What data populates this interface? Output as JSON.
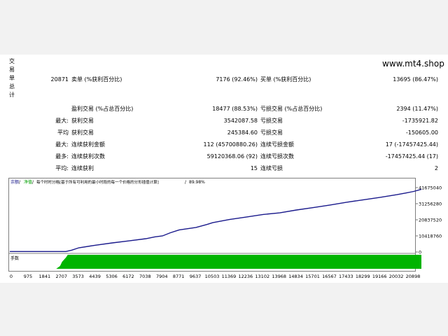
{
  "site_label": "www.mt4.shop",
  "side_label_chars": [
    "交",
    "易",
    "单",
    "总",
    "计"
  ],
  "rows": [
    {
      "c1": "",
      "c2": "20871",
      "c3": "卖单 (%获利百分比)",
      "c4": "7176 (92.46%)",
      "c5": "买单 (%获利百分比)",
      "c6": "13695 (86.47%)"
    },
    {
      "c1": "",
      "c2": "",
      "c3": "盈利交易 (%占总百分比)",
      "c4": "18477 (88.53%)",
      "c5": "亏损交易 (%占总百分比)",
      "c6": "2394 (11.47%)"
    },
    {
      "c1": "",
      "c2": "最大:",
      "c3": "获利交易",
      "c4": "3542087.58",
      "c5": "亏损交易",
      "c6": "-1735921.82"
    },
    {
      "c1": "",
      "c2": "平均",
      "c3": "获利交易",
      "c4": "245384.60",
      "c5": "亏损交易",
      "c6": "-150605.00"
    },
    {
      "c1": "",
      "c2": "最大:",
      "c3": "连续获利金额",
      "c4": "112 (45700880.26)",
      "c5": "连续亏损金额",
      "c6": "17 (-17457425.44)"
    },
    {
      "c1": "",
      "c2": "最多:",
      "c3": "连续获利次数",
      "c4": "59120368.06 (92)",
      "c5": "连续亏损次数",
      "c6": "-17457425.44 (17)"
    },
    {
      "c1": "",
      "c2": "平均:",
      "c3": "连续获利",
      "c4": "15",
      "c5": "连续亏损",
      "c6": "2"
    }
  ],
  "chart_header": {
    "balance": "余额",
    "equity": "净值",
    "caption": "每个时时分格[基于所有可利用的最小时段的每一个价格的分形插值计算]",
    "quality": "89.98%"
  },
  "lot_label": "手数",
  "colors": {
    "balance_line": "#1a1a8c",
    "lot_fill": "#00b400",
    "grid": "#d0d0d0"
  },
  "chart_data": {
    "type": "line",
    "title": "",
    "y_ticks": [
      "41675040",
      "31256280",
      "20837520",
      "10418760",
      "0"
    ],
    "y_tick_values": [
      41675040,
      31256280,
      20837520,
      10418760,
      0
    ],
    "x_ticks": [
      "0",
      "975",
      "1841",
      "2707",
      "3573",
      "4439",
      "5306",
      "6172",
      "7038",
      "7904",
      "8771",
      "9637",
      "10503",
      "11369",
      "12236",
      "13102",
      "13968",
      "14834",
      "15701",
      "16567",
      "17433",
      "18299",
      "19166",
      "20032",
      "20898"
    ],
    "ylim": [
      0,
      41675040
    ],
    "xlim": [
      0,
      21300
    ],
    "series": [
      {
        "name": "余额",
        "x": [
          0,
          1000,
          2000,
          2900,
          3200,
          3573,
          4439,
          5306,
          6172,
          7038,
          7500,
          7904,
          8300,
          8771,
          9637,
          10200,
          10503,
          11369,
          12236,
          13102,
          13968,
          14834,
          15701,
          16567,
          17433,
          18299,
          19166,
          20032,
          20500,
          20898,
          21300
        ],
        "y": [
          300000,
          300000,
          300000,
          300000,
          1200000,
          2700000,
          4400000,
          5900000,
          7200000,
          8600000,
          9800000,
          10400000,
          12400000,
          14300000,
          15900000,
          17800000,
          19000000,
          21000000,
          22600000,
          24300000,
          25300000,
          27200000,
          28700000,
          30400000,
          32200000,
          33800000,
          35400000,
          37100000,
          38200000,
          39200000,
          40600000
        ]
      }
    ],
    "lot_series": {
      "name": "手数",
      "x": [
        0,
        2400,
        2600,
        2707,
        2900,
        3000,
        3100,
        3200,
        21300
      ],
      "y": [
        0,
        0,
        0.2,
        0.5,
        0.8,
        1,
        1,
        1,
        1
      ]
    }
  }
}
